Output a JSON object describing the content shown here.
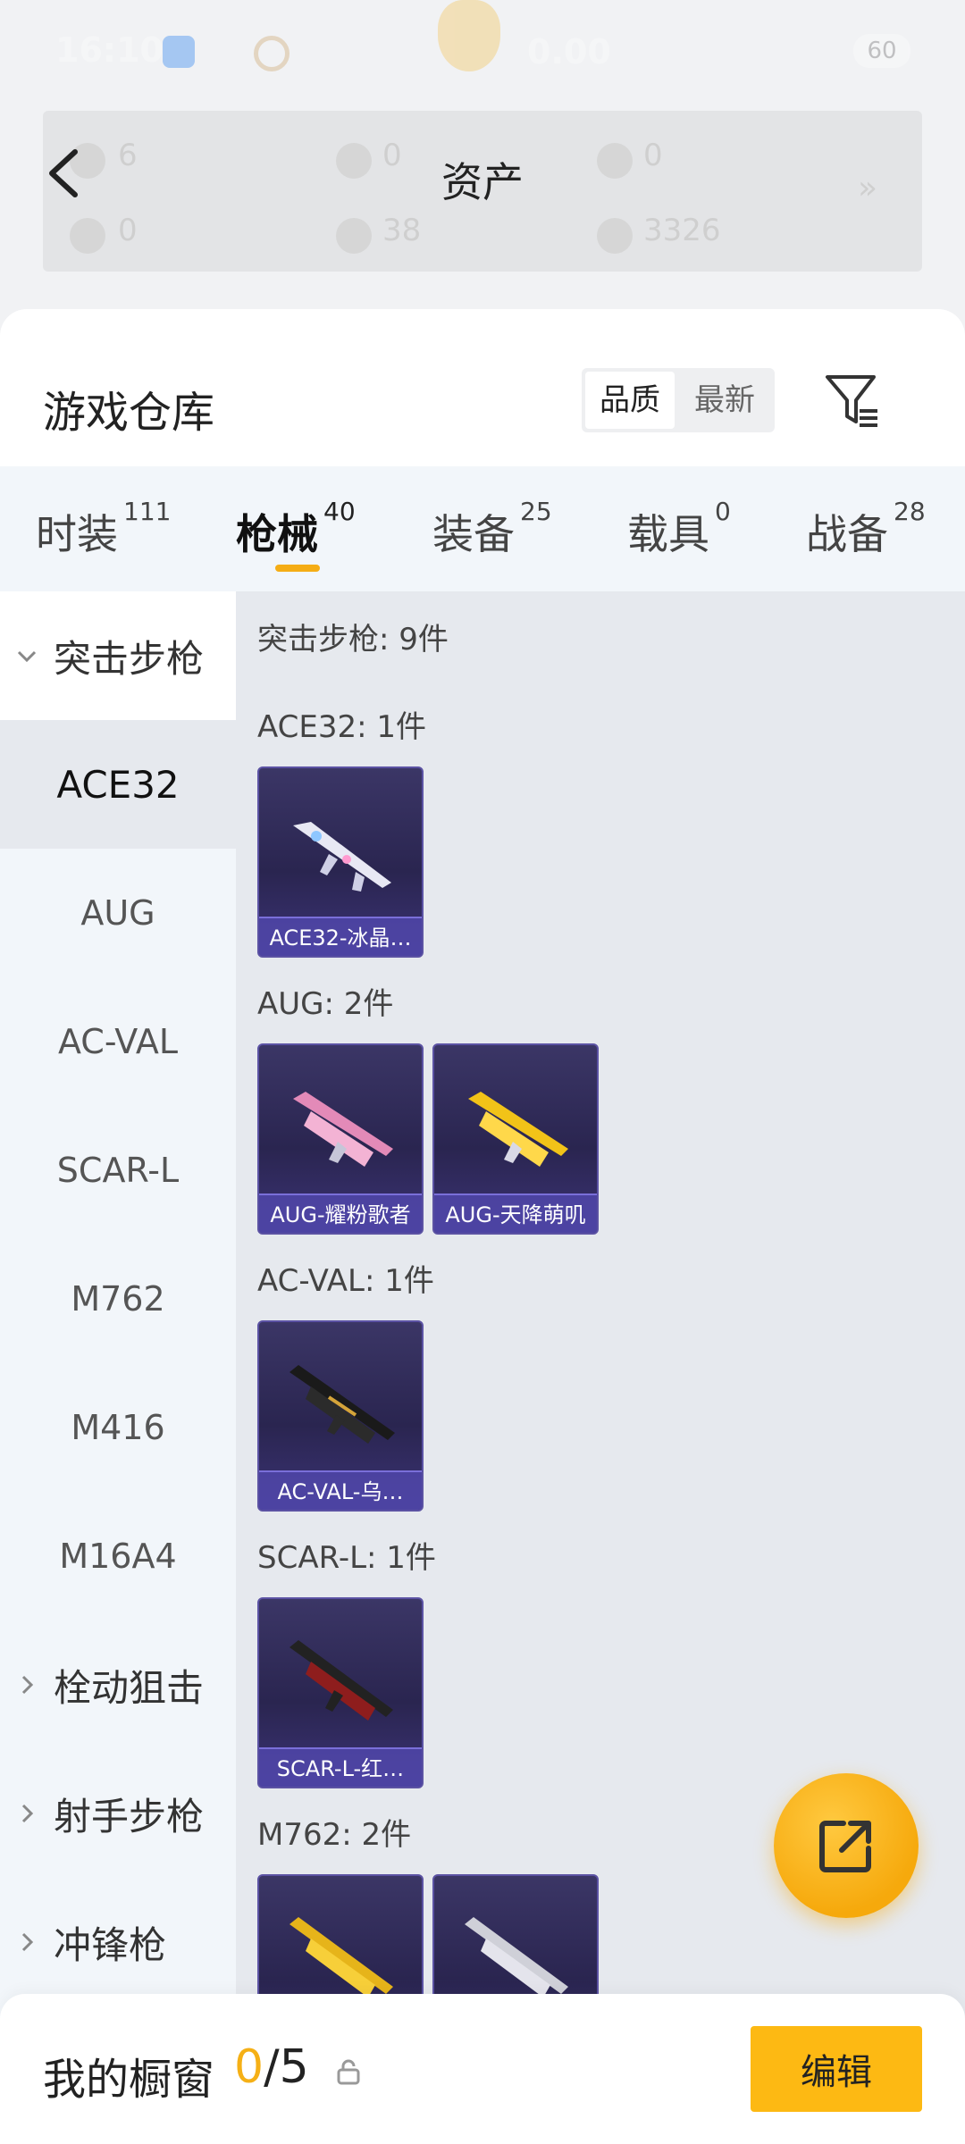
{
  "status_bar": {
    "time": "16:10",
    "speed": "0.00",
    "battery": "60"
  },
  "asset_bar": {
    "title": "资产",
    "values": [
      "6",
      "0",
      "0",
      "0",
      "38",
      "3326"
    ]
  },
  "warehouse": {
    "title": "游戏仓库",
    "sort_options": [
      "品质",
      "最新"
    ]
  },
  "category_tabs": [
    {
      "label": "时装",
      "count": "111"
    },
    {
      "label": "枪械",
      "count": "40"
    },
    {
      "label": "装备",
      "count": "25"
    },
    {
      "label": "载具",
      "count": "0"
    },
    {
      "label": "战备",
      "count": "28"
    }
  ],
  "sidebar": {
    "open_group": "突击步枪",
    "items": [
      "ACE32",
      "AUG",
      "AC-VAL",
      "SCAR-L",
      "M762",
      "M416",
      "M16A4"
    ],
    "collapsed_groups": [
      "栓动狙击",
      "射手步枪",
      "冲锋枪"
    ]
  },
  "main": {
    "summary": "突击步枪: 9件",
    "sections": [
      {
        "header": "ACE32: 1件",
        "items": [
          "ACE32-冰晶…"
        ]
      },
      {
        "header": "AUG: 2件",
        "items": [
          "AUG-耀粉歌者",
          "AUG-天降萌叽"
        ]
      },
      {
        "header": "AC-VAL: 1件",
        "items": [
          "AC-VAL-乌…"
        ]
      },
      {
        "header": "SCAR-L: 1件",
        "items": [
          "SCAR-L-红…"
        ]
      },
      {
        "header": "M762: 2件",
        "items": [
          "",
          ""
        ]
      }
    ]
  },
  "bottom_bar": {
    "title": "我的橱窗",
    "count_current": "0",
    "count_total": "/5",
    "edit_label": "编辑"
  },
  "colors": {
    "accent": "#f5b016",
    "card_bg": "#2a2550",
    "card_label": "#5046aa",
    "sidebar_bg": "#f2f6fa",
    "main_bg": "#e6e9ee"
  }
}
